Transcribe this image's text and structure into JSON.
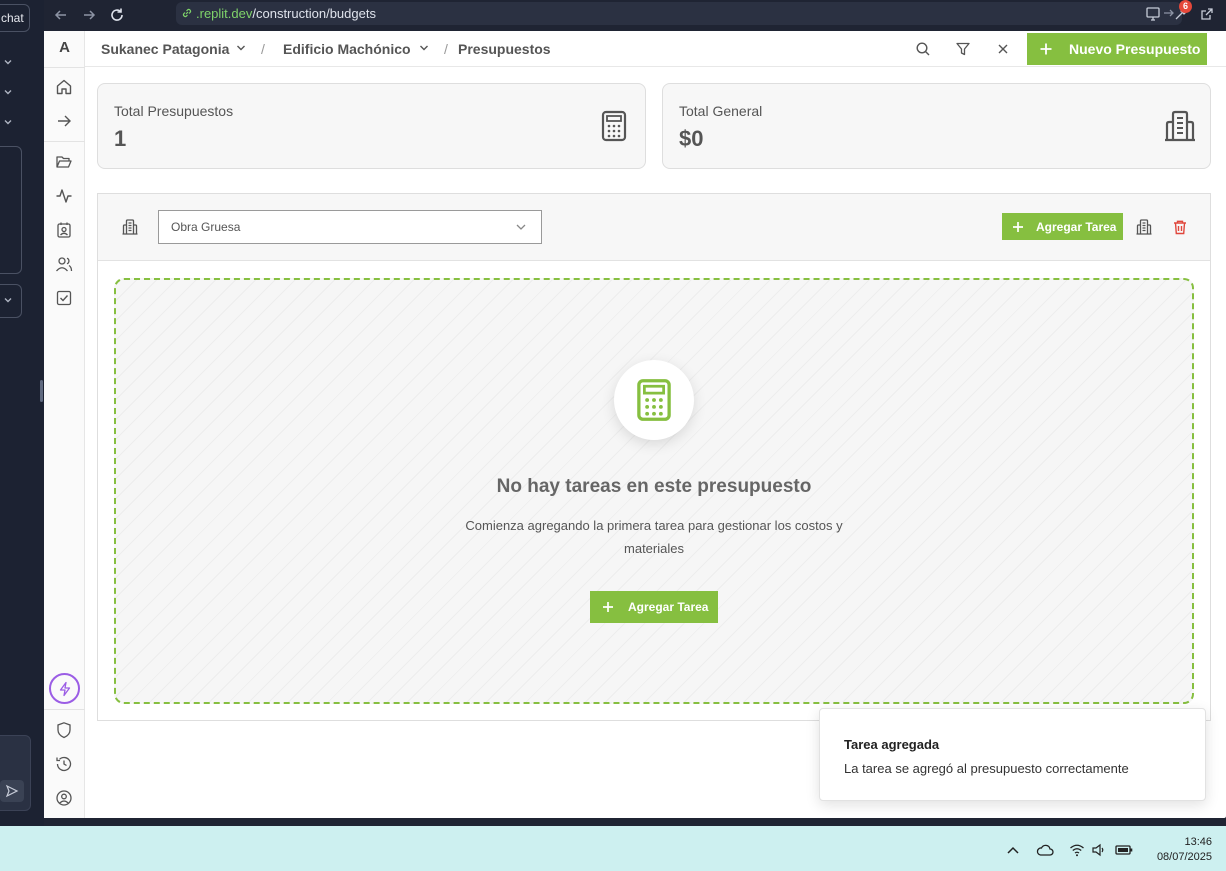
{
  "left_panel": {
    "chat_label": "chat"
  },
  "browser": {
    "url_host": ".replit.dev",
    "url_path": "/construction/budgets",
    "notification_count": "6"
  },
  "app": {
    "logo": "A",
    "breadcrumb": {
      "project": "Sukanec Patagonia",
      "building": "Edificio Machónico",
      "section": "Presupuestos",
      "separator": "/"
    },
    "new_budget_label": "Nuevo Presupuesto",
    "summary": {
      "total_budgets_label": "Total Presupuestos",
      "total_budgets_value": "1",
      "total_general_label": "Total General",
      "total_general_value": "$0"
    },
    "budget": {
      "selected_budget": "Obra Gruesa",
      "add_task_label": "Agregar Tarea",
      "empty_title": "No hay tareas en este presupuesto",
      "empty_description": "Comienza agregando la primera tarea para gestionar los costos y materiales",
      "empty_add_task_label": "Agregar Tarea"
    },
    "toast": {
      "title": "Tarea agregada",
      "message": "La tarea se agregó al presupuesto correctamente"
    },
    "accent_color": "#86bf40"
  },
  "taskbar": {
    "time": "13:46",
    "date": "08/07/2025"
  }
}
